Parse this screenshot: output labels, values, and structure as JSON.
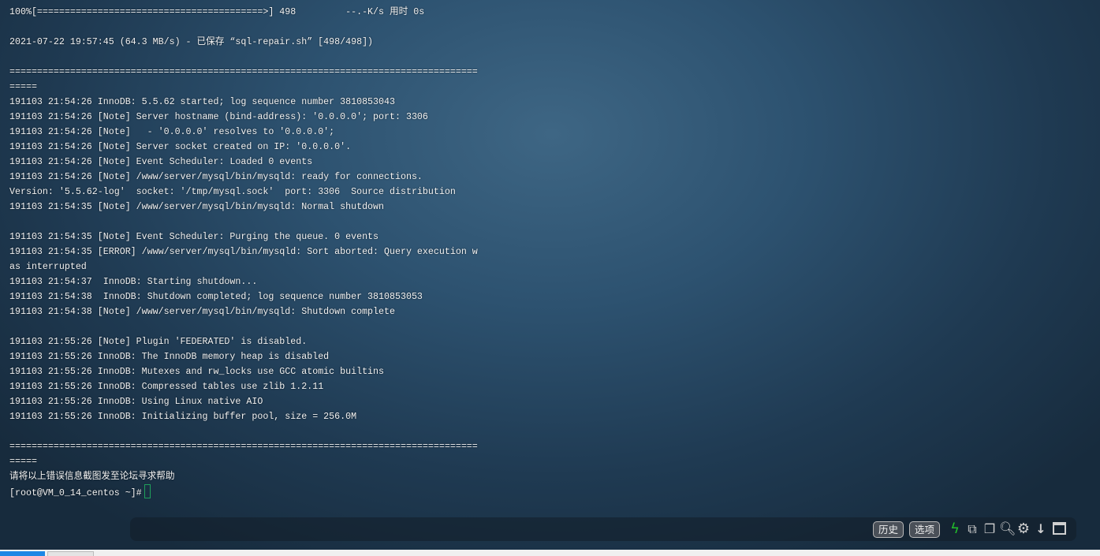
{
  "terminal": {
    "lines": [
      "100%[=========================================>] 498         --.-K/s 用时 0s",
      "",
      "2021-07-22 19:57:45 (64.3 MB/s) - 已保存 “sql-repair.sh” [498/498])",
      "",
      "=====================================================================================",
      "=====",
      "191103 21:54:26 InnoDB: 5.5.62 started; log sequence number 3810853043",
      "191103 21:54:26 [Note] Server hostname (bind-address): '0.0.0.0'; port: 3306",
      "191103 21:54:26 [Note]   - '0.0.0.0' resolves to '0.0.0.0';",
      "191103 21:54:26 [Note] Server socket created on IP: '0.0.0.0'.",
      "191103 21:54:26 [Note] Event Scheduler: Loaded 0 events",
      "191103 21:54:26 [Note] /www/server/mysql/bin/mysqld: ready for connections.",
      "Version: '5.5.62-log'  socket: '/tmp/mysql.sock'  port: 3306  Source distribution",
      "191103 21:54:35 [Note] /www/server/mysql/bin/mysqld: Normal shutdown",
      "",
      "191103 21:54:35 [Note] Event Scheduler: Purging the queue. 0 events",
      "191103 21:54:35 [ERROR] /www/server/mysql/bin/mysqld: Sort aborted: Query execution w",
      "as interrupted",
      "191103 21:54:37  InnoDB: Starting shutdown...",
      "191103 21:54:38  InnoDB: Shutdown completed; log sequence number 3810853053",
      "191103 21:54:38 [Note] /www/server/mysql/bin/mysqld: Shutdown complete",
      "",
      "191103 21:55:26 [Note] Plugin 'FEDERATED' is disabled.",
      "191103 21:55:26 InnoDB: The InnoDB memory heap is disabled",
      "191103 21:55:26 InnoDB: Mutexes and rw_locks use GCC atomic builtins",
      "191103 21:55:26 InnoDB: Compressed tables use zlib 1.2.11",
      "191103 21:55:26 InnoDB: Using Linux native AIO",
      "191103 21:55:26 InnoDB: Initializing buffer pool, size = 256.0M",
      "",
      "=====================================================================================",
      "=====",
      "请将以上错误信息截图发至论坛寻求帮助"
    ],
    "prompt": "[root@VM_0_14_centos ~]#"
  },
  "toolbar": {
    "history_label": "历史",
    "options_label": "选项",
    "icons": [
      "lightning-icon",
      "copy-icon",
      "paste-icon",
      "search-icon",
      "gear-icon",
      "download-icon",
      "maximize-icon"
    ],
    "accent_color": "#22c02a"
  }
}
